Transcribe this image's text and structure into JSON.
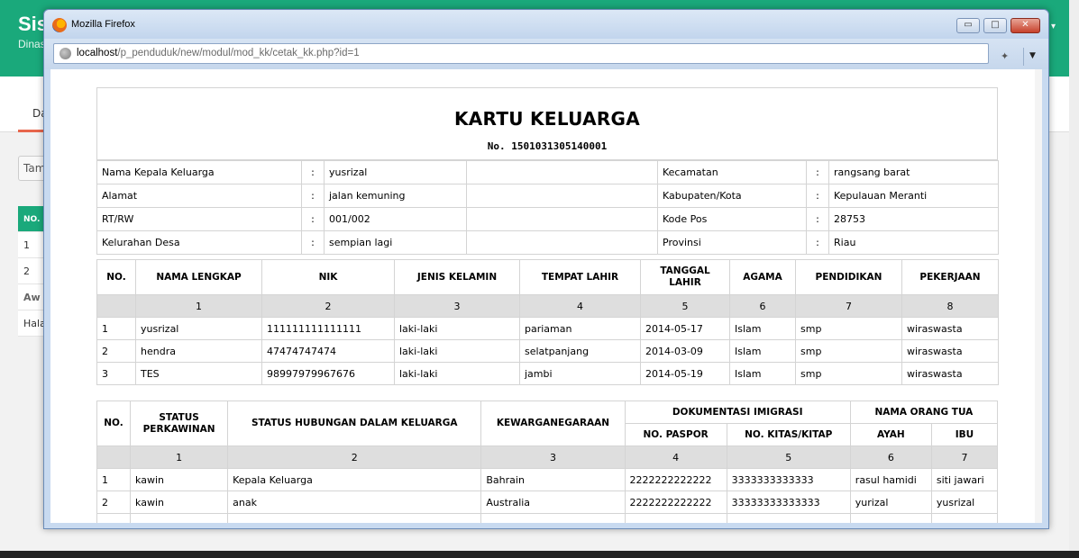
{
  "background": {
    "site_title": "Sis",
    "site_subtitle": "Dinas",
    "nav_item": "Da",
    "button_label": "Tam",
    "table_header": "NO.",
    "rows": [
      "1",
      "2",
      "Aw",
      "Hala"
    ]
  },
  "browser": {
    "title": "Mozilla Firefox",
    "url_host": "localhost",
    "url_path": "/p_penduduk/new/modul/mod_kk/cetak_kk.php?id=1",
    "min_icon": "▭",
    "max_icon": "□",
    "close_icon": "✕",
    "menu_arrow": "▼"
  },
  "document": {
    "title": "KARTU KELUARGA",
    "number": "No. 1501031305140001",
    "info": [
      {
        "label": "Nama Kepala Keluarga",
        "value": "yusrizal",
        "label2": "Kecamatan",
        "value2": "rangsang barat"
      },
      {
        "label": "Alamat",
        "value": "jalan kemuning",
        "label2": "Kabupaten/Kota",
        "value2": "Kepulauan Meranti"
      },
      {
        "label": "RT/RW",
        "value": "001/002",
        "label2": "Kode Pos",
        "value2": "28753"
      },
      {
        "label": "Kelurahan Desa",
        "value": "sempian lagi",
        "label2": "Provinsi",
        "value2": "Riau"
      }
    ],
    "colon": ":",
    "members": {
      "headers": [
        "NO.",
        "NAMA LENGKAP",
        "NIK",
        "JENIS KELAMIN",
        "TEMPAT LAHIR",
        "TANGGAL LAHIR",
        "AGAMA",
        "PENDIDIKAN",
        "PEKERJAAN"
      ],
      "numbers": [
        "1",
        "2",
        "3",
        "4",
        "5",
        "6",
        "7",
        "8"
      ],
      "rows": [
        [
          "1",
          "yusrizal",
          "111111111111111",
          "laki-laki",
          "pariaman",
          "2014-05-17",
          "Islam",
          "smp",
          "wiraswasta"
        ],
        [
          "2",
          "hendra",
          "47474747474",
          "laki-laki",
          "selatpanjang",
          "2014-03-09",
          "Islam",
          "smp",
          "wiraswasta"
        ],
        [
          "3",
          "TES",
          "98997979967676",
          "laki-laki",
          "jambi",
          "2014-05-19",
          "Islam",
          "smp",
          "wiraswasta"
        ]
      ]
    },
    "status": {
      "headers": {
        "no": "NO.",
        "perkawinan": "STATUS PERKAWINAN",
        "hubungan": "STATUS HUBUNGAN DALAM KELUARGA",
        "kewarganegaraan": "KEWARGANEGARAAN",
        "dokumentasi": "DOKUMENTASI IMIGRASI",
        "paspor": "NO. PASPOR",
        "kitas": "NO. KITAS/KITAP",
        "orang_tua": "NAMA ORANG TUA",
        "ayah": "AYAH",
        "ibu": "IBU"
      },
      "numbers": [
        "1",
        "2",
        "3",
        "4",
        "5",
        "6",
        "7"
      ],
      "rows": [
        [
          "1",
          "kawin",
          "Kepala Keluarga",
          "Bahrain",
          "2222222222222",
          "3333333333333",
          "rasul hamidi",
          "siti jawari"
        ],
        [
          "2",
          "kawin",
          "anak",
          "Australia",
          "2222222222222",
          "33333333333333",
          "yurizal",
          "yusrizal"
        ]
      ]
    }
  }
}
